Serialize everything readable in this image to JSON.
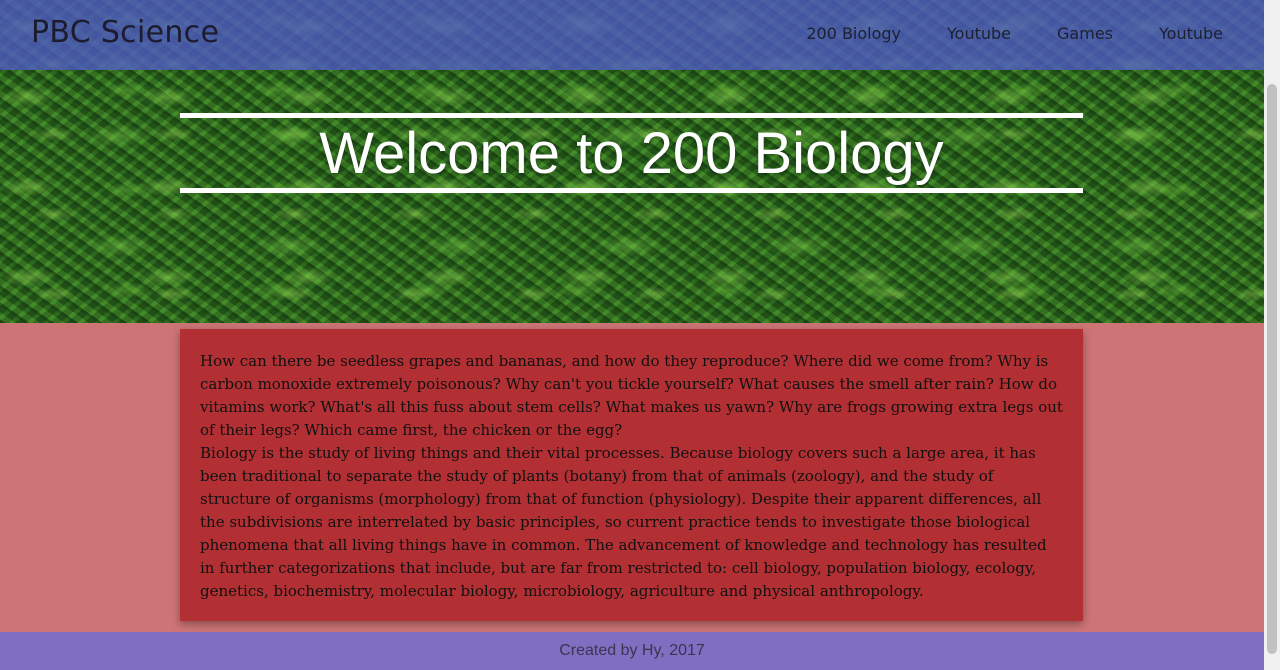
{
  "navbar": {
    "brand": "PBC Science",
    "links": [
      "200 Biology",
      "Youtube",
      "Games",
      "Youtube"
    ]
  },
  "hero": {
    "title": "Welcome to 200 Biology"
  },
  "content": {
    "paragraph_1": "How can there be seedless grapes and bananas, and how do they reproduce? Where did we come from? Why is carbon monoxide extremely poisonous? Why can't you tickle yourself? What causes the smell after rain? How do vitamins work? What's all this fuss about stem cells? What makes us yawn? Why are frogs growing extra legs out of their legs? Which came first, the chicken or the egg?",
    "paragraph_2": "Biology is the study of living things and their vital processes. Because biology covers such a large area, it has been traditional to separate the study of plants (botany) from that of animals (zoology), and the study of structure of organisms (morphology) from that of function (physiology). Despite their apparent differences, all the subdivisions are interrelated by basic principles, so current practice tends to investigate those biological phenomena that all living things have in common. The advancement of knowledge and technology has resulted in further categorizations that include, but are far from restricted to: cell biology, population biology, ecology, genetics, biochemistry, molecular biology, microbiology, agriculture and physical anthropology."
  },
  "footer": {
    "text": "Created by Hy, 2017"
  },
  "colors": {
    "navbar_tint": "#505ac8",
    "content_bg": "#b22f33",
    "page_bg": "#cd7476",
    "footer_bg": "#7f6ec1"
  }
}
